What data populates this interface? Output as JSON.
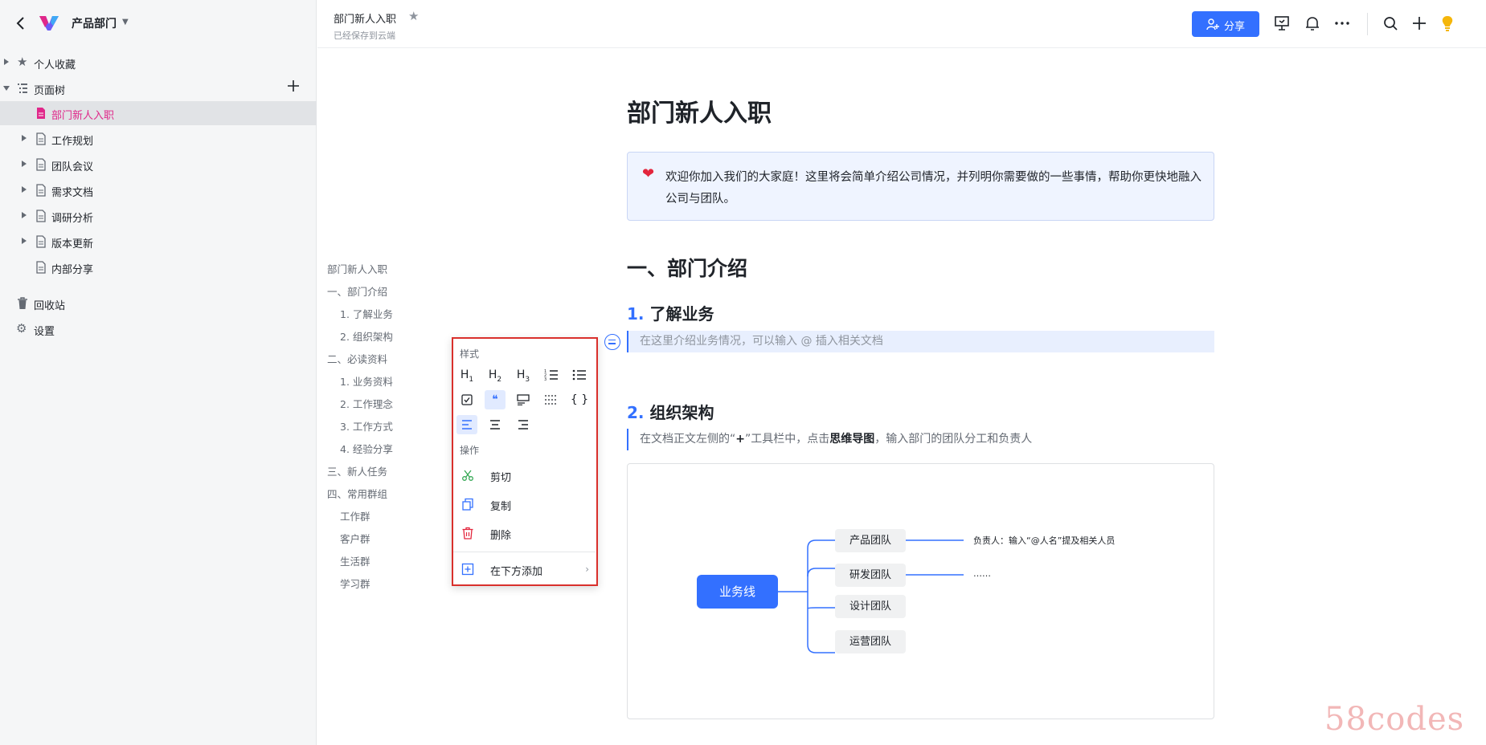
{
  "sidebar": {
    "space_name": "产品部门",
    "favorites": "个人收藏",
    "page_tree": "页面树",
    "pages": [
      "部门新人入职",
      "工作规划",
      "团队会议",
      "需求文档",
      "调研分析",
      "版本更新",
      "内部分享"
    ],
    "recycle": "回收站",
    "settings": "设置"
  },
  "topbar": {
    "doc_title": "部门新人入职",
    "saved_status": "已经保存到云端",
    "share_label": "分享"
  },
  "outline": [
    "部门新人入职",
    "一、部门介绍",
    "1. 了解业务",
    "2. 组织架构",
    "二、必读资料",
    "1. 业务资料",
    "2. 工作理念",
    "3. 工作方式",
    "4. 经验分享",
    "三、新人任务",
    "四、常用群组",
    "工作群",
    "客户群",
    "生活群",
    "学习群"
  ],
  "document": {
    "title": "部门新人入职",
    "callout": "欢迎你加入我们的大家庭！这里将会简单介绍公司情况，并列明你需要做的一些事情，帮助你更快地融入公司与团队。",
    "section1": "一、部门介绍",
    "sub1_num": "1.",
    "sub1_title": "了解业务",
    "sub1_placeholder": "在这里介绍业务情况，可以输入 @ 插入相关文档",
    "sub2_num": "2.",
    "sub2_title": "组织架构",
    "sub2_text_a": "在文档正文左侧的“",
    "sub2_text_plus": "+",
    "sub2_text_b": "”工具栏中，点击",
    "sub2_text_bold": "思维导图",
    "sub2_text_c": "，输入部门的团队分工和负责人"
  },
  "mindmap": {
    "root": "业务线",
    "nodes": [
      "产品团队",
      "研发团队",
      "设计团队",
      "运营团队"
    ],
    "note1": "负责人：输入“@人名”提及相关人员",
    "note2": "……"
  },
  "menu": {
    "style_label": "样式",
    "styles": [
      "H1",
      "H2",
      "H3",
      "ordered-list",
      "bullet-list",
      "todo",
      "quote",
      "callout",
      "divider",
      "code",
      "align-left",
      "align-center",
      "align-right"
    ],
    "ops_label": "操作",
    "cut": "剪切",
    "copy": "复制",
    "delete": "删除",
    "add_below": "在下方添加"
  },
  "watermark": "58codes",
  "colors": {
    "accent": "#3370ff",
    "active_page": "#e0288a",
    "menu_border": "#d9302c"
  }
}
